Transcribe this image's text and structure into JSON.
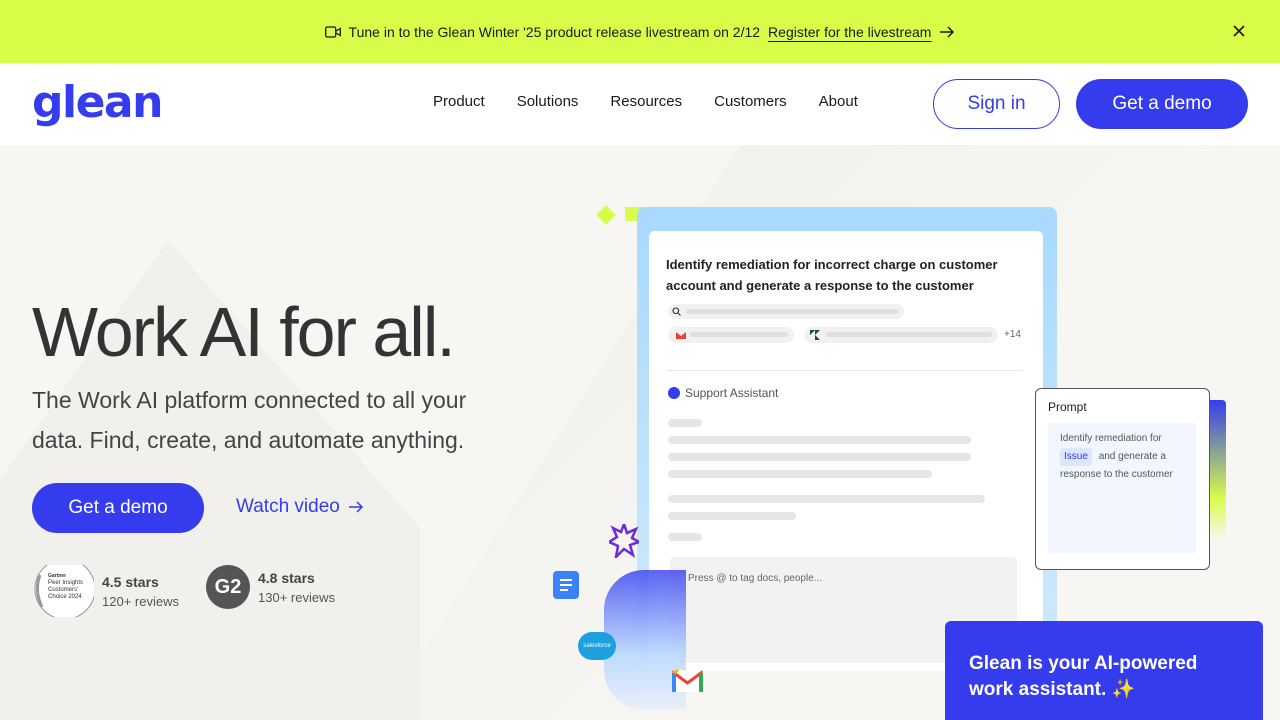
{
  "banner": {
    "text": "Tune in to the Glean Winter '25 product release livestream on 2/12",
    "link": "Register for the livestream",
    "icons": [
      "video-camera-icon",
      "arrow-right-icon",
      "close-icon"
    ]
  },
  "header": {
    "logo": "glean",
    "nav": [
      "Product",
      "Solutions",
      "Resources",
      "Customers",
      "About"
    ],
    "sign_in": "Sign in",
    "get_demo": "Get a demo"
  },
  "hero": {
    "title": "Work AI for all.",
    "subtitle": "The Work AI platform connected to all your data. Find, create, and automate anything.",
    "cta_primary": "Get a demo",
    "cta_secondary": "Watch video",
    "ratings": [
      {
        "badge_lines": [
          "Gartner",
          "Peer Insights",
          "Customers'",
          "Choice 2024"
        ],
        "stars": "4.5 stars",
        "reviews": "120+ reviews"
      },
      {
        "badge_text": "G2",
        "stars": "4.8 stars",
        "reviews": "130+ reviews"
      }
    ]
  },
  "illustration": {
    "query": "Identify remediation for incorrect charge on customer account and generate a response to the customer",
    "sources_more": "+14",
    "assistant_name": "Support Assistant",
    "input_placeholder": "Press @ to tag docs, people...",
    "prompt": {
      "title": "Prompt",
      "text_before": "Identify remediation for",
      "tag": "Issue",
      "text_after": "and generate a response to the customer"
    },
    "salesforce_label": "salesforce"
  },
  "chat": {
    "text": "Glean is your AI-powered work assistant. ✨"
  },
  "colors": {
    "brand": "#343ced",
    "banner": "#d8fd49"
  }
}
